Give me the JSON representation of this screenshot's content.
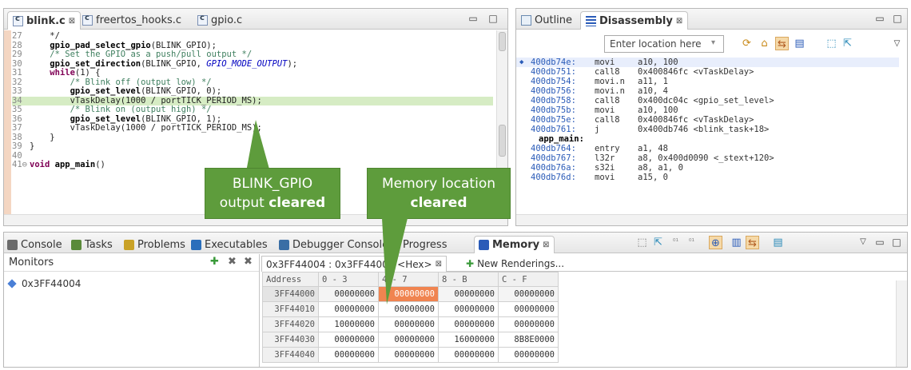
{
  "editor": {
    "tabs": [
      {
        "label": "blink.c",
        "close": "⊠"
      },
      {
        "label": "freertos_hooks.c"
      },
      {
        "label": "gpio.c"
      }
    ],
    "lines": [
      {
        "num": "27",
        "html": "    */"
      },
      {
        "num": "28",
        "html": "    <span class=\"fn\">gpio_pad_select_gpio</span>(BLINK_GPIO);"
      },
      {
        "num": "29",
        "html": "    <span class=\"cm\">/* Set the GPIO as a push/pull output */</span>"
      },
      {
        "num": "30",
        "html": "    <span class=\"fn\">gpio_set_direction</span>(BLINK_GPIO, <span class=\"it\">GPIO_MODE_OUTPUT</span>);"
      },
      {
        "num": "31",
        "html": "    <span class=\"kw\">while</span>(1) {"
      },
      {
        "num": "32",
        "html": "        <span class=\"cm\">/* Blink off (output low) */</span>"
      },
      {
        "num": "33",
        "html": "        <span class=\"fn\">gpio_set_level</span>(BLINK_GPIO, 0);"
      },
      {
        "num": "34",
        "html": "        vTaskDelay(1000 / portTICK_PERIOD_MS);",
        "hl": true
      },
      {
        "num": "35",
        "html": "        <span class=\"cm\">/* Blink on (output high) */</span>"
      },
      {
        "num": "36",
        "html": "        <span class=\"fn\">gpio_set_level</span>(BLINK_GPIO, 1);"
      },
      {
        "num": "37",
        "html": "        vTaskDelay(1000 / portTICK_PERIOD_MS);"
      },
      {
        "num": "38",
        "html": "    }"
      },
      {
        "num": "39",
        "html": "}"
      },
      {
        "num": "40",
        "html": ""
      },
      {
        "num": "41⊖",
        "html": "<span class=\"kw\">void</span> <span class=\"fn\">app_main</span>()"
      }
    ]
  },
  "disassembly": {
    "tabs": [
      {
        "label": "Outline"
      },
      {
        "label": "Disassembly",
        "close": "⊠"
      }
    ],
    "location_placeholder": "Enter location here",
    "rows": [
      {
        "addr": "400db74e:",
        "op": "movi",
        "args": "a10, 100",
        "cur": true
      },
      {
        "addr": "400db751:",
        "op": "call8",
        "args": "0x400846fc <vTaskDelay>"
      },
      {
        "addr": "400db754:",
        "op": "movi.n",
        "args": "a11, 1"
      },
      {
        "addr": "400db756:",
        "op": "movi.n",
        "args": "a10, 4"
      },
      {
        "addr": "400db758:",
        "op": "call8",
        "args": "0x400dc04c <gpio_set_level>"
      },
      {
        "addr": "400db75b:",
        "op": "movi",
        "args": "a10, 100"
      },
      {
        "addr": "400db75e:",
        "op": "call8",
        "args": "0x400846fc <vTaskDelay>"
      },
      {
        "addr": "400db761:",
        "op": "j",
        "args": "0x400db746 <blink_task+18>"
      },
      {
        "addr": "app_main:",
        "op": "",
        "args": "",
        "label": true
      },
      {
        "addr": "400db764:",
        "op": "entry",
        "args": "a1, 48"
      },
      {
        "addr": "400db767:",
        "op": "l32r",
        "args": "a8, 0x400d0090 <_stext+120>"
      },
      {
        "addr": "400db76a:",
        "op": "s32i",
        "args": "a8, a1, 0"
      },
      {
        "addr": "400db76d:",
        "op": "movi",
        "args": "a15, 0"
      }
    ]
  },
  "bottom": {
    "tabs": [
      {
        "label": "Console",
        "color": "#6b6b6b"
      },
      {
        "label": "Tasks",
        "color": "#5a8a3a"
      },
      {
        "label": "Problems",
        "color": "#c9a227"
      },
      {
        "label": "Executables",
        "color": "#2a6ebb"
      },
      {
        "label": "Debugger Console",
        "color": "#3a6ea5"
      },
      {
        "label": "Progress",
        "color": "#7a7a7a"
      },
      {
        "label": "Memory",
        "color": "#2a5bb8",
        "close": "⊠"
      }
    ],
    "monitors": {
      "title": "Monitors",
      "items": [
        "0x3FF44004"
      ]
    },
    "renderings": {
      "active_tab": "0x3FF44004 : 0x3FF44004 <Hex>",
      "close": "⊠",
      "new_tab": "New Renderings..."
    },
    "memory": {
      "headers": [
        "Address",
        "0 - 3",
        "4 - 7",
        "8 - B",
        "C - F"
      ],
      "rows": [
        {
          "addr": "3FF44000",
          "cells": [
            "00000000",
            "00000000",
            "00000000",
            "00000000"
          ],
          "selected": true
        },
        {
          "addr": "3FF44010",
          "cells": [
            "00000000",
            "00000000",
            "00000000",
            "00000000"
          ]
        },
        {
          "addr": "3FF44020",
          "cells": [
            "10000000",
            "00000000",
            "00000000",
            "00000000"
          ]
        },
        {
          "addr": "3FF44030",
          "cells": [
            "00000000",
            "00000000",
            "16000000",
            "8B8E0000"
          ]
        },
        {
          "addr": "3FF44040",
          "cells": [
            "00000000",
            "00000000",
            "00000000",
            "00000000"
          ]
        }
      ]
    }
  },
  "callouts": {
    "gpio": {
      "line1": "BLINK_GPIO",
      "line2a": "output ",
      "line2b": "cleared"
    },
    "memory": {
      "line1": "Memory location",
      "line2": "cleared"
    }
  },
  "colors": {
    "callout": "#5e9c3c",
    "highlight_line": "#d6ecc4",
    "changed_cell": "#f08450"
  }
}
